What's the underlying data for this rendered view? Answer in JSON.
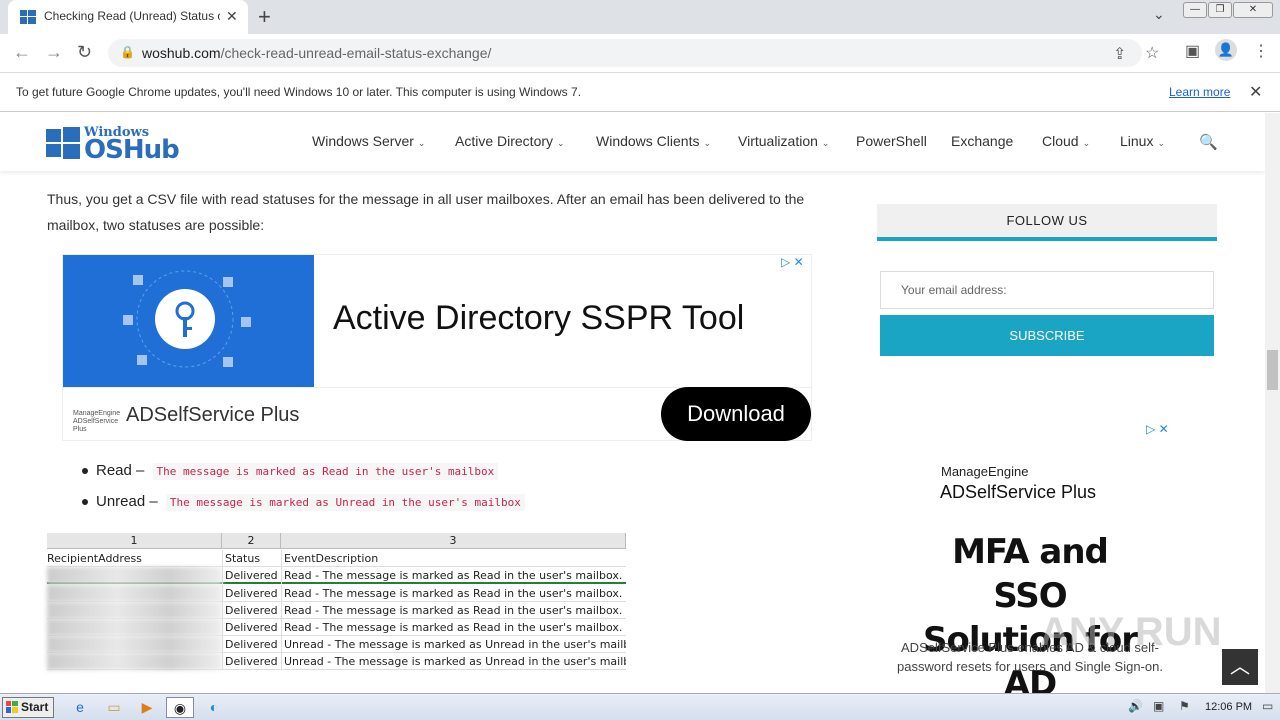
{
  "browser": {
    "tab_title": "Checking Read (Unread) Status of E",
    "url_host": "woshub.com",
    "url_path": "/check-read-unread-email-status-exchange/",
    "infobar_message": "To get future Google Chrome updates, you'll need Windows 10 or later. This computer is using Windows 7.",
    "infobar_link": "Learn more"
  },
  "site": {
    "logo_top": "Windows",
    "logo_main": "OSHub",
    "nav": [
      {
        "label": "Windows Server",
        "dropdown": true
      },
      {
        "label": "Active Directory",
        "dropdown": true
      },
      {
        "label": "Windows Clients",
        "dropdown": true
      },
      {
        "label": "Virtualization",
        "dropdown": true
      },
      {
        "label": "PowerShell",
        "dropdown": false
      },
      {
        "label": "Exchange",
        "dropdown": false
      },
      {
        "label": "Cloud",
        "dropdown": true
      },
      {
        "label": "Linux",
        "dropdown": true
      }
    ]
  },
  "article": {
    "paragraph": "Thus, you get a CSV file with read statuses for the message in all user mailboxes. After an email has been delivered to the mailbox, two statuses are possible:",
    "bullets": [
      {
        "term": "Read",
        "sep": "–",
        "code": "The message is marked as Read in the user's mailbox"
      },
      {
        "term": "Unread",
        "sep": "–",
        "code": "The message is marked as Unread in the user's mailbox"
      }
    ]
  },
  "ad_main": {
    "headline": "Active Directory SSPR Tool",
    "brand_small": "ManageEngine ADSelfService Plus",
    "brand": "ADSelfService Plus",
    "cta": "Download"
  },
  "sheet": {
    "col_numbers": [
      "1",
      "2",
      "3"
    ],
    "headers": [
      "RecipientAddress",
      "Status",
      "EventDescription"
    ],
    "rows": [
      {
        "status": "Delivered",
        "desc": "Read - The message is marked as Read in the user's mailbox."
      },
      {
        "status": "Delivered",
        "desc": "Read - The message is marked as Read in the user's mailbox."
      },
      {
        "status": "Delivered",
        "desc": "Read - The message is marked as Read in the user's mailbox."
      },
      {
        "status": "Delivered",
        "desc": "Read - The message is marked as Read in the user's mailbox."
      },
      {
        "status": "Delivered",
        "desc": "Unread - The message is marked as Unread in the user's mailbox"
      },
      {
        "status": "Delivered",
        "desc": "Unread - The message is marked as Unread in the user's mailbox"
      }
    ]
  },
  "sidebar": {
    "follow_title": "FOLLOW US",
    "email_placeholder": "Your email address:",
    "subscribe_label": "SUBSCRIBE",
    "ad": {
      "manageengine": "ManageEngine",
      "product": "ADSelfService Plus",
      "headline_line1": "MFA and SSO",
      "headline_line2": "Solution for AD",
      "desc": "ADSelfService Plus enables AD & cloud self-password resets for users and Single Sign-on."
    }
  },
  "taskbar": {
    "start_label": "Start",
    "clock": "12:06 PM"
  },
  "watermark": "ANY RUN",
  "colors": {
    "accent": "#1aa5c4",
    "logo_blue": "#2a6dbb",
    "code_red": "#c7254e"
  }
}
